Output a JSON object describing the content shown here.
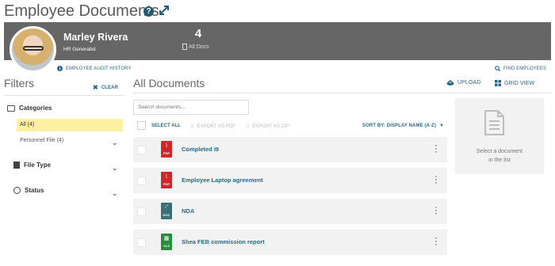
{
  "page": {
    "title": "Employee Documents"
  },
  "icons": {
    "help": "help-icon",
    "expand": "expand-icon",
    "upload": "cloud-upload-icon",
    "grid": "grid-icon",
    "search": "search-icon",
    "info": "info-icon",
    "clear": "close-icon"
  },
  "employee": {
    "name": "Marley Rivera",
    "role": "HR Generalist",
    "doc_count": "4",
    "doc_count_label": "All Docs"
  },
  "links": {
    "audit_history": "EMPLOYEE AUDIT HISTORY",
    "find_employees": "FIND EMPLOYEES"
  },
  "filters": {
    "title": "Filters",
    "clear": "CLEAR",
    "categories_label": "Categories",
    "category_all": "All",
    "category_all_count": "(4)",
    "category_personnel": "Personnel File",
    "category_personnel_count": "(4)",
    "file_type_label": "File Type",
    "status_label": "Status"
  },
  "documents": {
    "title": "All Documents",
    "upload": "UPLOAD",
    "grid_view": "GRID VIEW",
    "search_placeholder": "Search documents...",
    "select_all": "SELECT ALL",
    "export_pdf": "EXPORT AS PDF",
    "export_zip": "EXPORT AS ZIP",
    "sort_by": "SORT BY: DISPLAY NAME (A-Z)",
    "rows": [
      {
        "name": "Completed I9",
        "type": "PDF",
        "color": "#d0272c"
      },
      {
        "name": "Employee Laptop agreement",
        "type": "PDF",
        "color": "#d0272c"
      },
      {
        "name": "NDA",
        "type": "DOC",
        "color": "#3a6f78"
      },
      {
        "name": "Shea FEB commission report",
        "type": "XLS",
        "color": "#2e8b3e"
      }
    ]
  },
  "preview": {
    "line1": "Select a document",
    "line2": "in the list"
  },
  "colors": {
    "accent": "#2a6a86",
    "banner": "#666666",
    "selected_filter": "#fbf1a1"
  }
}
